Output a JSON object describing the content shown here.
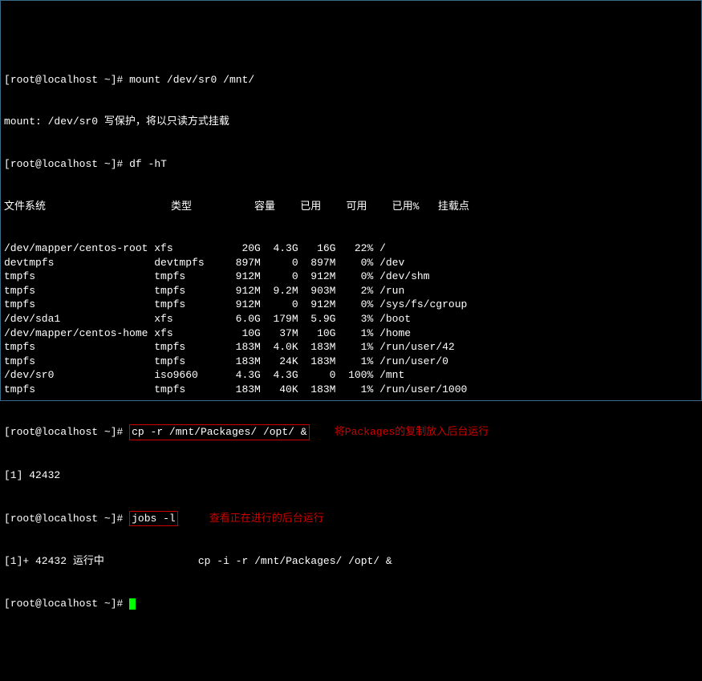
{
  "prompt": {
    "user": "root",
    "host": "localhost",
    "cwd": "~",
    "symbol": "#"
  },
  "commands": {
    "mount": "mount /dev/sr0 /mnt/",
    "mount_response_prefix": "mount: /dev/sr0",
    "mount_response_cn": "写保护，将以只读方式挂载",
    "df": "df -hT",
    "cp": "cp -r /mnt/Packages/ /opt/ &",
    "jobs": "jobs -l"
  },
  "annotations": {
    "cp_note": "将Packages的复制放入后台运行",
    "jobs_note": "查看正在进行的后台运行"
  },
  "job": {
    "spawn": "[1] 42432",
    "status_prefix": "[1]+ 42432",
    "status_cn": "运行中",
    "cmd": "cp -i -r /mnt/Packages/ /opt/ &"
  },
  "df": {
    "headers": {
      "fs": "文件系统",
      "type": "类型",
      "size": "容量",
      "used": "已用",
      "avail": "可用",
      "usep": "已用%",
      "mount": "挂载点"
    },
    "rows": [
      {
        "fs": "/dev/mapper/centos-root",
        "type": "xfs",
        "size": "20G",
        "used": "4.3G",
        "avail": "16G",
        "usep": "22%",
        "mount": "/"
      },
      {
        "fs": "devtmpfs",
        "type": "devtmpfs",
        "size": "897M",
        "used": "0",
        "avail": "897M",
        "usep": "0%",
        "mount": "/dev"
      },
      {
        "fs": "tmpfs",
        "type": "tmpfs",
        "size": "912M",
        "used": "0",
        "avail": "912M",
        "usep": "0%",
        "mount": "/dev/shm"
      },
      {
        "fs": "tmpfs",
        "type": "tmpfs",
        "size": "912M",
        "used": "9.2M",
        "avail": "903M",
        "usep": "2%",
        "mount": "/run"
      },
      {
        "fs": "tmpfs",
        "type": "tmpfs",
        "size": "912M",
        "used": "0",
        "avail": "912M",
        "usep": "0%",
        "mount": "/sys/fs/cgroup"
      },
      {
        "fs": "/dev/sda1",
        "type": "xfs",
        "size": "6.0G",
        "used": "179M",
        "avail": "5.9G",
        "usep": "3%",
        "mount": "/boot"
      },
      {
        "fs": "/dev/mapper/centos-home",
        "type": "xfs",
        "size": "10G",
        "used": "37M",
        "avail": "10G",
        "usep": "1%",
        "mount": "/home"
      },
      {
        "fs": "tmpfs",
        "type": "tmpfs",
        "size": "183M",
        "used": "4.0K",
        "avail": "183M",
        "usep": "1%",
        "mount": "/run/user/42"
      },
      {
        "fs": "tmpfs",
        "type": "tmpfs",
        "size": "183M",
        "used": "24K",
        "avail": "183M",
        "usep": "1%",
        "mount": "/run/user/0"
      },
      {
        "fs": "/dev/sr0",
        "type": "iso9660",
        "size": "4.3G",
        "used": "4.3G",
        "avail": "0",
        "usep": "100%",
        "mount": "/mnt"
      },
      {
        "fs": "tmpfs",
        "type": "tmpfs",
        "size": "183M",
        "used": "40K",
        "avail": "183M",
        "usep": "1%",
        "mount": "/run/user/1000"
      }
    ]
  }
}
